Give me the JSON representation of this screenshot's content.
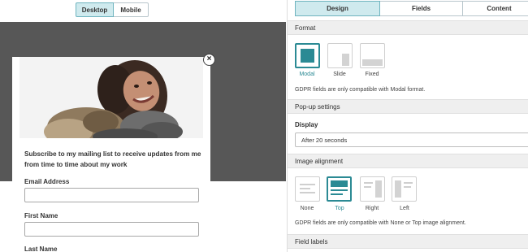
{
  "preview": {
    "device_toggle": {
      "desktop": "Desktop",
      "mobile": "Mobile",
      "selected": "Desktop"
    },
    "popup": {
      "close_symbol": "×",
      "headline": "Subscribe to my mailing list to receive updates from me from time to time about my work",
      "fields": [
        {
          "label": "Email Address",
          "value": ""
        },
        {
          "label": "First Name",
          "value": ""
        },
        {
          "label": "Last Name"
        }
      ]
    }
  },
  "settings": {
    "tabs": [
      {
        "label": "Design"
      },
      {
        "label": "Fields"
      },
      {
        "label": "Content"
      }
    ],
    "active_tab": "Design",
    "format": {
      "heading": "Format",
      "options": [
        {
          "label": "Modal"
        },
        {
          "label": "Slide"
        },
        {
          "label": "Fixed"
        }
      ],
      "selected": "Modal",
      "note": "GDPR fields are only compatible with Modal format."
    },
    "popup_settings": {
      "heading": "Pop-up settings",
      "display_label": "Display",
      "display_value": "After 20 seconds"
    },
    "image_alignment": {
      "heading": "Image alignment",
      "options": [
        {
          "label": "None"
        },
        {
          "label": "Top"
        },
        {
          "label": "Right"
        },
        {
          "label": "Left"
        }
      ],
      "selected": "Top",
      "note": "GDPR fields are only compatible with None or Top image alignment."
    },
    "field_labels": {
      "heading": "Field labels"
    }
  },
  "colors": {
    "accent": "#2b8a94",
    "tab_active_bg": "#cfeaee",
    "preview_backdrop": "#575757"
  }
}
